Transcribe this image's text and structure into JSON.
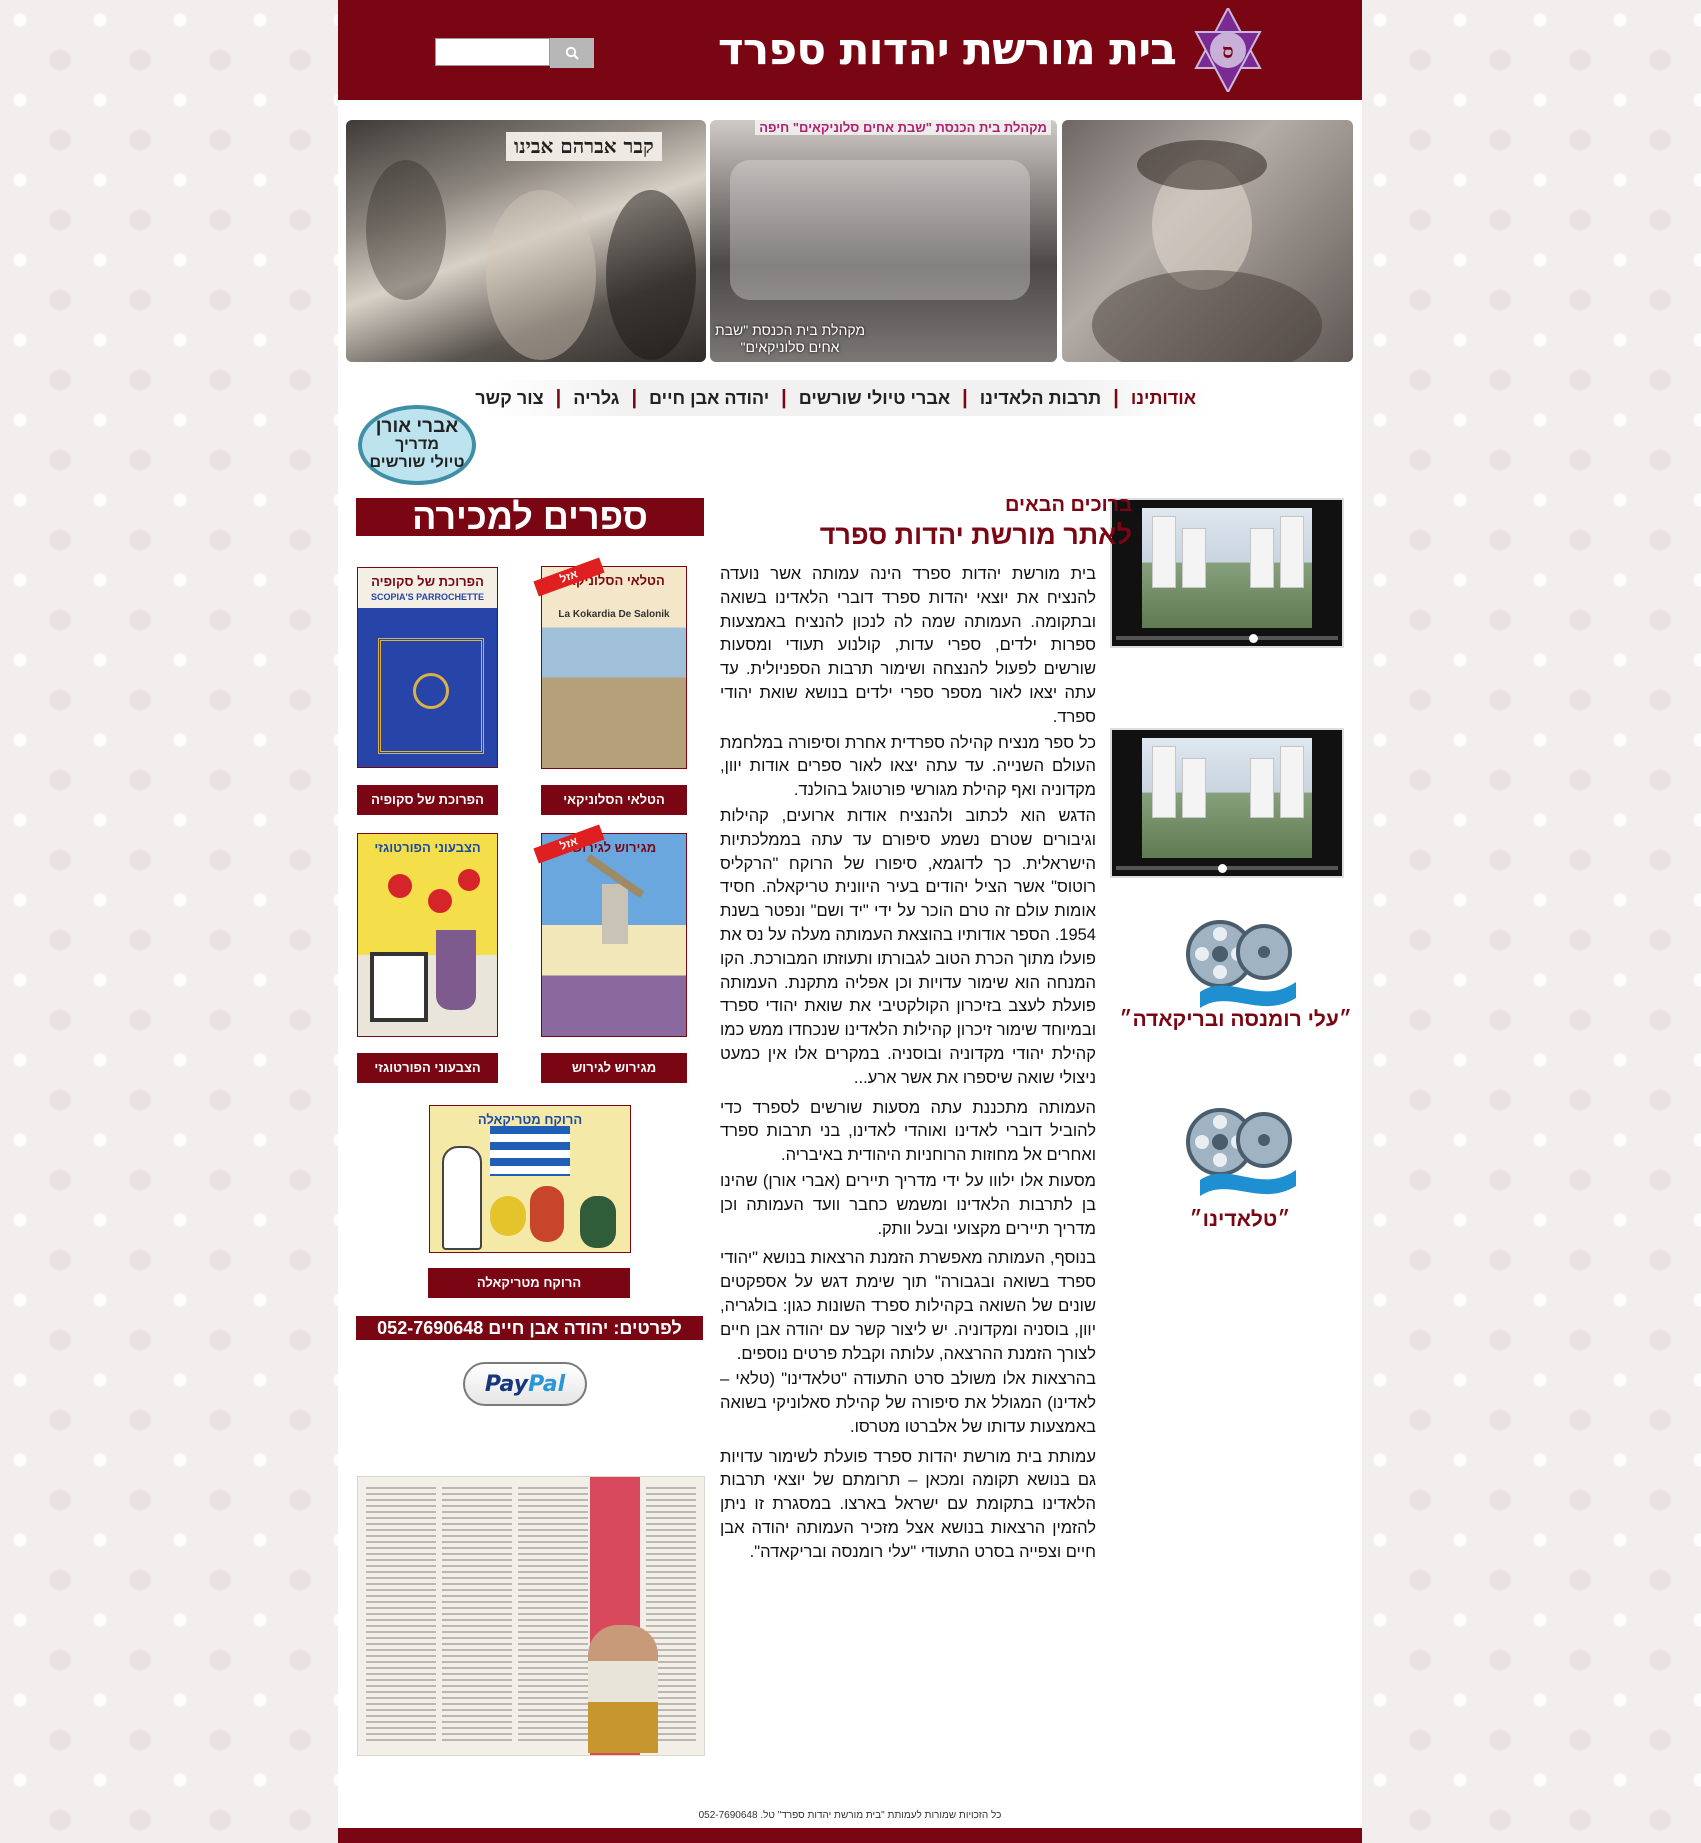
{
  "header": {
    "site_title": "בית מורשת יהדות ספרד",
    "search_placeholder": ""
  },
  "banner": {
    "middle_photo_caption": "מקהלת בית הכנסת \"שבת אחים סלוניקאים\"",
    "middle_photo_top": "מקהלת בית הכנסת \"שבת אחים סלוניקאים\" חיפה",
    "left_photo_sign": "קבר אברהם אבינו"
  },
  "nav": {
    "items": [
      {
        "label": "אודותינו",
        "active": true
      },
      {
        "label": "תרבות הלאדינו",
        "active": false
      },
      {
        "label": "אברי טיולי שורשים",
        "active": false
      },
      {
        "label": "יהודה אבן חיים",
        "active": false
      },
      {
        "label": "גלריה",
        "active": false
      },
      {
        "label": "צור קשר",
        "active": false
      }
    ]
  },
  "guide_badge": {
    "line1": "אברי אורן",
    "line2": "מדריך",
    "line3": "טיולי שורשים"
  },
  "welcome": {
    "subtitle": "ברוכים הבאים",
    "title": "לאתר מורשת יהדות ספרד"
  },
  "article": {
    "paragraphs": [
      "בית מורשת יהדות ספרד הינה עמותה אשר נועדה להנציח את יוצאי יהדות ספרד דוברי הלאדינו בשואה ובתקומה. העמותה שמה לה לנכון להנציח באמצעות ספרות ילדים, ספרי עדות, קולנוע תעודי ומסעות שורשים לפעול להנצחה ושימור תרבות הספניולית. עד עתה יצאו לאור מספר ספרי ילדים בנושא שואת יהודי ספרד.",
      "כל ספר מנציח קהילה ספרדית אחרת וסיפורה במלחמת העולם השנייה. עד עתה יצאו לאור ספרים אודות יוון, מקדוניה ואף קהילת מגורשי פורטוגל בהולנד.",
      "הדגש הוא לכתוב ולהנציח אודות ארועים, קהילות וגיבורים שטרם נשמע סיפורם עד עתה בממלכתיות הישראלית. כך לדוגמא, סיפורו של הרוקח \"הרקליס רוטוס\" אשר הציל יהודים  בעיר היוונית טריקאלה. חסיד אומות עולם זה טרם הוכר על ידי \"יד ושם\" ונפטר בשנת 1954. הספר אודותיו בהוצאת העמותה מעלה על נס את פועלו מתוך הכרת הטוב לגבורתו ותעוזתו המבורכת. הקו המנחה הוא שימור עדויות וכן אפליה מתקנת. העמותה פועלת לעצב בזיכרון הקולקטיבי את שואת יהודי ספרד ובמיוחד שימור זיכרון קהילות הלאדינו שנכחדו ממש כמו קהילת יהודי מקדוניה ובוסניה. במקרים אלו אין כמעט ניצולי שואה שיספרו את אשר ארע...",
      "העמותה מתכננת עתה מסעות שורשים לספרד כדי להוביל דוברי לאדינו ואוהדי לאדינו, בני תרבות ספרד ואחרים אל מחוזות הרוחניות היהודית באיבריה.",
      "מסעות אלו ילווו על ידי מדריך תיירים (אברי אורן) שהינו בן לתרבות הלאדינו ומשמש כחבר וועד העמותה וכן מדריך תיירים מקצועי ובעל וותק.",
      "בנוסף, העמותה מאפשרת הזמנת הרצאות בנושא \"יהודי ספרד בשואה ובגבורה\" תוך שימת דגש על אספקטים שונים של השואה בקהילות ספרד השונות כגון: בולגריה, יוון, בוסניה ומקדוניה. יש ליצור קשר עם יהודה אבן חיים לצורך הזמנת ההרצאה, עלותה וקבלת פרטים נוספים.",
      "בהרצאות אלו משולב סרט התעודה \"טלאדינו\" (טלאי – לאדינו) המגולל את סיפורה של קהילת סאלוניקי בשואה באמצעות עדותו של אלברטו מטרסו.",
      "עמותת בית מורשת יהדות ספרד פועלת לשימור עדויות גם בנושא תקומה ומכאן – תרומתם של יוצאי תרבות הלאדינו בתקומת עם ישראל בארצו. במסגרת זו ניתן להזמין הרצאות בנושא אצל מזכיר העמותה יהודה אבן חיים וצפייה בסרט התעודי \"עלי רומנסה ובריקאדה\"."
    ]
  },
  "books": {
    "banner": "ספרים למכירה",
    "items": [
      {
        "cover_title": "הטלאי הסלוניקאי",
        "cover_subtitle": "La Kokardia De Salonik",
        "label": "הטלאי הסלוניקאי",
        "ribbon": "אזל"
      },
      {
        "cover_title": "הפרוכת של סקופיה",
        "cover_subtitle": "SCOPIA'S PARROCHETTE",
        "label": "הפרוכת של סקופיה",
        "ribbon": ""
      },
      {
        "cover_title": "מגירוש לגירוש",
        "cover_subtitle": "",
        "label": "מגירוש לגירוש",
        "ribbon": "אזל"
      },
      {
        "cover_title": "הצבעוני הפורטוגזי",
        "cover_subtitle": "",
        "label": "הצבעוני הפורטוגזי",
        "ribbon": ""
      },
      {
        "cover_title": "הרוקח מטריקאלה",
        "cover_subtitle": "",
        "label": "הרוקח מטריקאלה",
        "ribbon": ""
      }
    ]
  },
  "contact": "לפרטים: יהודה אבן חיים 052-7690648",
  "paypal": {
    "pay": "Pay",
    "pal": "Pal"
  },
  "videos": {
    "film1_label": "״עלי רומנסה ובריקאדה״",
    "film2_label": "״טלאדינו״"
  },
  "footer": "כל הזכויות שמורות לעמותת \"בית מורשת יהדות ספרד\" טל. 052-7690648",
  "colors": {
    "brand": "#7a0613",
    "ribbon": "#e02020"
  }
}
